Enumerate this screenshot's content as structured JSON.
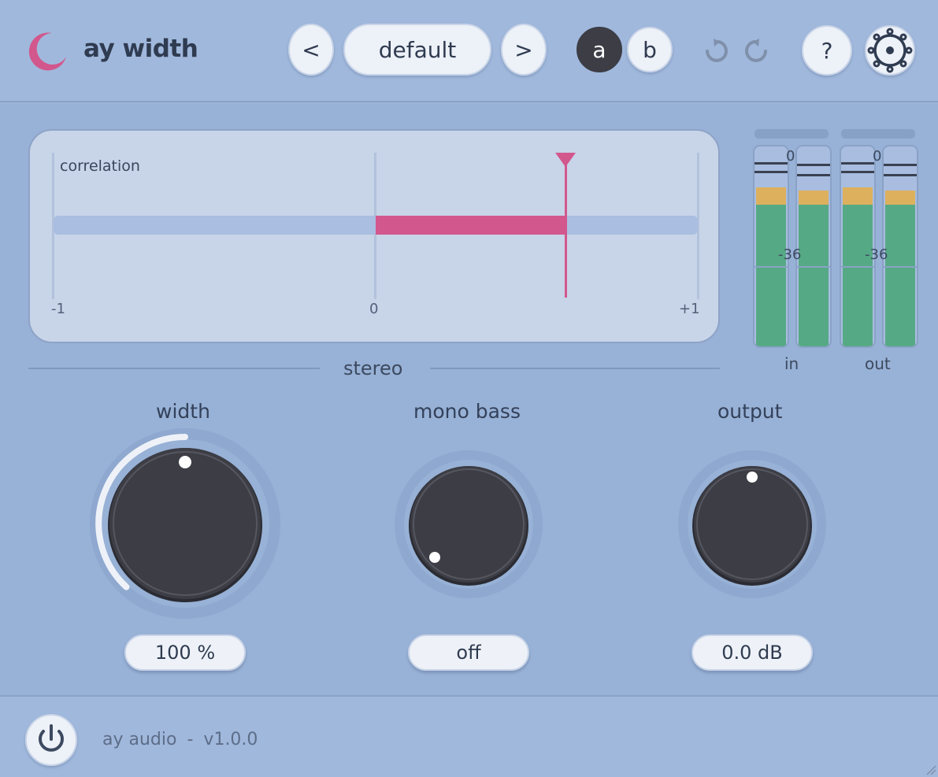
{
  "header": {
    "title": "ay width",
    "prev_label": "<",
    "preset": "default",
    "next_label": ">",
    "ab_a": "a",
    "ab_b": "b",
    "help_label": "?",
    "icons": [
      "logo-icon",
      "undo-icon",
      "redo-icon",
      "settings-icon"
    ]
  },
  "correlation": {
    "label": "correlation",
    "scale_min": "-1",
    "scale_mid": "0",
    "scale_max": "+1",
    "value": 0.59
  },
  "meters": {
    "top_scale": "0",
    "mid_scale": "-36",
    "in_label": "in",
    "out_label": "out"
  },
  "section": {
    "title": "stereo"
  },
  "knobs": {
    "width": {
      "title": "width",
      "value": "100 %"
    },
    "mono_bass": {
      "title": "mono bass",
      "value": "off"
    },
    "output": {
      "title": "output",
      "value": "0.0 dB"
    }
  },
  "footer": {
    "brand": "ay audio",
    "separator": "-",
    "version": "v1.0.0",
    "icons": [
      "power-icon"
    ]
  },
  "colors": {
    "accent": "#d2578c",
    "background": "#98b1d6",
    "knob": "#3c3d45",
    "meter_green": "#56a985",
    "meter_peak": "#ddb05e"
  }
}
